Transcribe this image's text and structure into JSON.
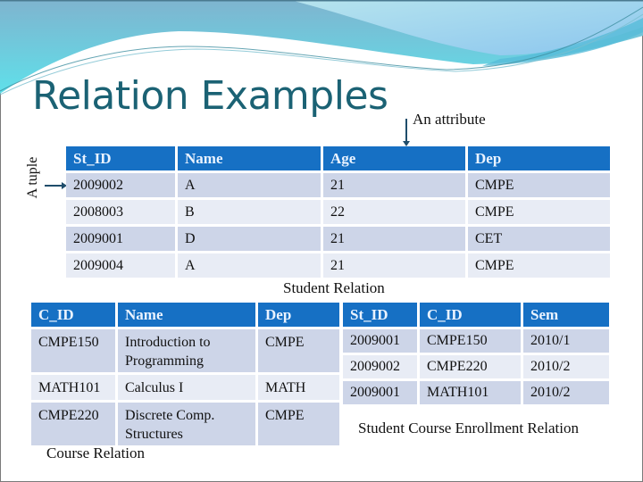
{
  "slide": {
    "title": "Relation Examples",
    "colors": {
      "title": "#1b6274",
      "header_bg": "#1670c4",
      "header_text": "#eaf3ff",
      "row_dark": "#cdd5e8",
      "row_light": "#e8ecf5",
      "arrow": "#1f4d6b"
    }
  },
  "annotations": {
    "tuple_label": "A tuple",
    "attribute_label": "An attribute"
  },
  "student_relation": {
    "caption": "Student Relation",
    "columns": [
      "St_ID",
      "Name",
      "Age",
      "Dep"
    ],
    "rows": [
      [
        "2009002",
        "A",
        "21",
        "CMPE"
      ],
      [
        "2008003",
        "B",
        "22",
        "CMPE"
      ],
      [
        "2009001",
        "D",
        "21",
        "CET"
      ],
      [
        "2009004",
        "A",
        "21",
        "CMPE"
      ]
    ]
  },
  "course_relation": {
    "caption": "Course Relation",
    "columns": [
      "C_ID",
      "Name",
      "Dep"
    ],
    "rows": [
      [
        "CMPE150",
        "Introduction to Programming",
        "CMPE"
      ],
      [
        "MATH101",
        "Calculus I",
        "MATH"
      ],
      [
        "CMPE220",
        "Discrete Comp. Structures",
        "CMPE"
      ]
    ]
  },
  "enrollment_relation": {
    "caption": "Student Course Enrollment Relation",
    "columns": [
      "St_ID",
      "C_ID",
      "Sem"
    ],
    "rows": [
      [
        "2009001",
        "CMPE150",
        "2010/1"
      ],
      [
        "2009002",
        "CMPE220",
        "2010/2"
      ],
      [
        "2009001",
        "MATH101",
        "2010/2"
      ]
    ]
  }
}
